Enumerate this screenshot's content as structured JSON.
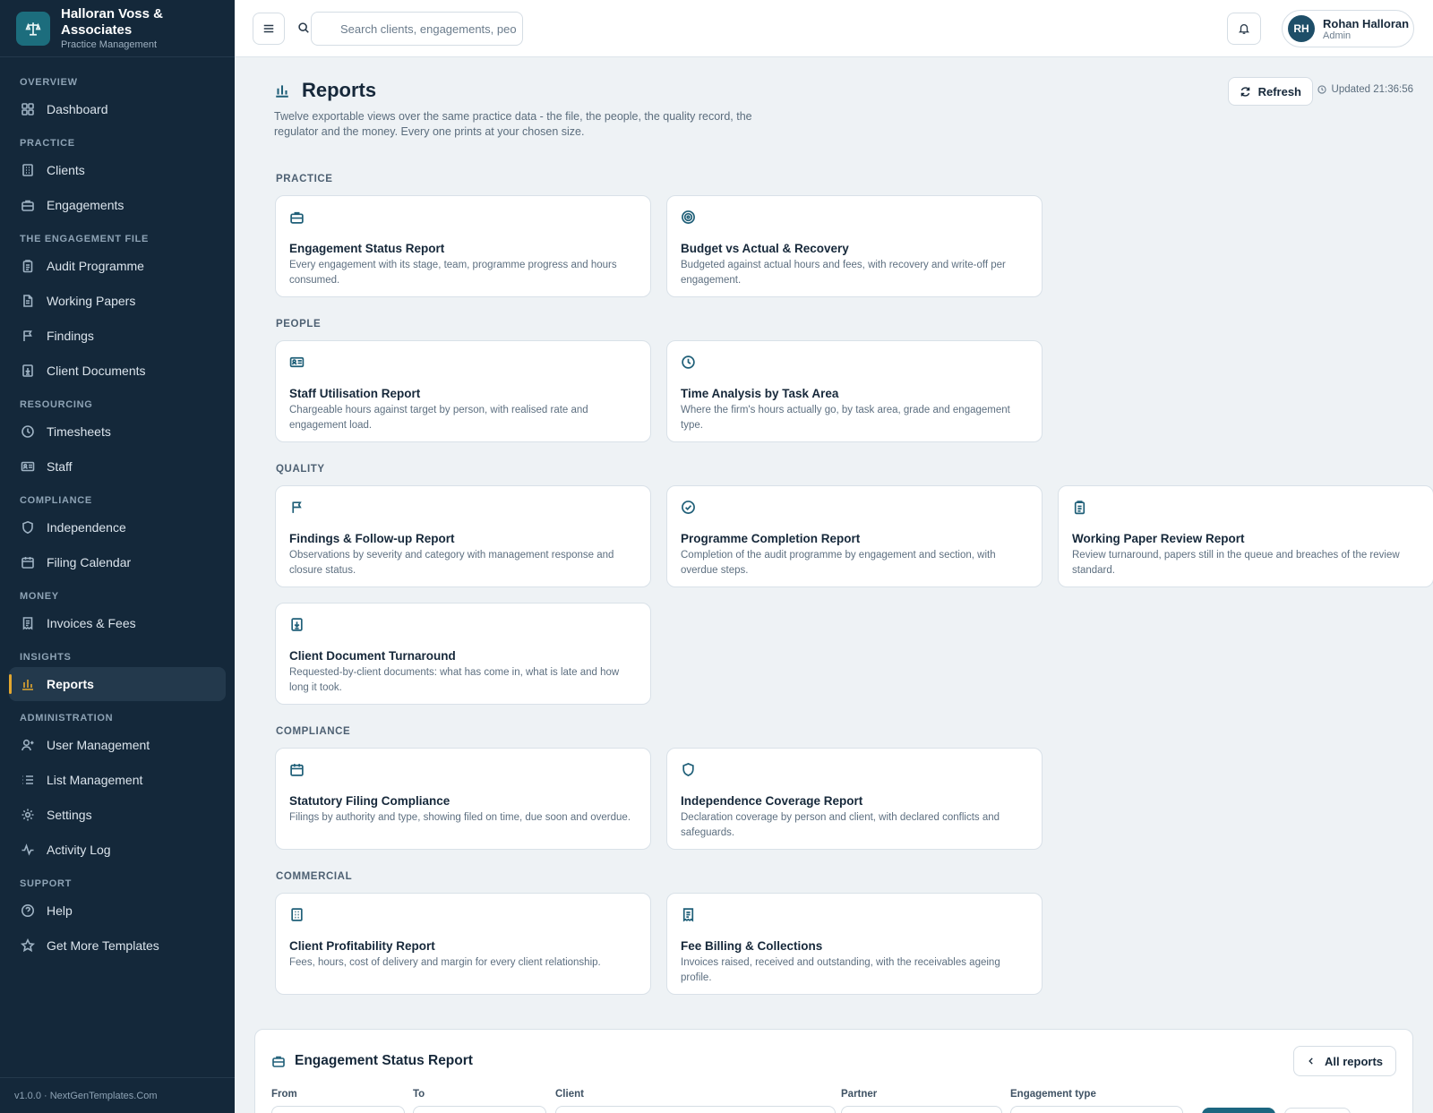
{
  "brand": {
    "name": "Halloran Voss & Associates",
    "subtitle": "Practice Management"
  },
  "sidebar": {
    "sections": [
      {
        "label": "OVERVIEW",
        "items": [
          {
            "label": "Dashboard",
            "icon": "grid-icon"
          }
        ]
      },
      {
        "label": "PRACTICE",
        "items": [
          {
            "label": "Clients",
            "icon": "building-icon"
          },
          {
            "label": "Engagements",
            "icon": "briefcase-icon"
          }
        ]
      },
      {
        "label": "THE ENGAGEMENT FILE",
        "items": [
          {
            "label": "Audit Programme",
            "icon": "clipboard-icon"
          },
          {
            "label": "Working Papers",
            "icon": "file-icon"
          },
          {
            "label": "Findings",
            "icon": "flag-icon"
          },
          {
            "label": "Client Documents",
            "icon": "file-download-icon"
          }
        ]
      },
      {
        "label": "RESOURCING",
        "items": [
          {
            "label": "Timesheets",
            "icon": "clock-icon"
          },
          {
            "label": "Staff",
            "icon": "id-card-icon"
          }
        ]
      },
      {
        "label": "COMPLIANCE",
        "items": [
          {
            "label": "Independence",
            "icon": "shield-icon"
          },
          {
            "label": "Filing Calendar",
            "icon": "calendar-icon"
          }
        ]
      },
      {
        "label": "MONEY",
        "items": [
          {
            "label": "Invoices & Fees",
            "icon": "receipt-icon"
          }
        ]
      },
      {
        "label": "INSIGHTS",
        "items": [
          {
            "label": "Reports",
            "icon": "bar-chart-icon",
            "active": true
          }
        ]
      },
      {
        "label": "ADMINISTRATION",
        "items": [
          {
            "label": "User Management",
            "icon": "user-icon"
          },
          {
            "label": "List Management",
            "icon": "list-icon"
          },
          {
            "label": "Settings",
            "icon": "gear-icon"
          },
          {
            "label": "Activity Log",
            "icon": "activity-icon"
          }
        ]
      },
      {
        "label": "SUPPORT",
        "items": [
          {
            "label": "Help",
            "icon": "help-icon"
          },
          {
            "label": "Get More Templates",
            "icon": "star-icon"
          }
        ]
      }
    ],
    "footer": "v1.0.0 · NextGenTemplates.Com"
  },
  "topbar": {
    "search_placeholder": "Search clients, engagements, peo",
    "user": {
      "initials": "RH",
      "name": "Rohan Halloran",
      "role": "Admin"
    }
  },
  "page": {
    "title": "Reports",
    "subtitle": "Twelve exportable views over the same practice data - the file, the people, the quality record, the regulator and the money. Every one prints at your chosen size.",
    "refresh_label": "Refresh",
    "updated_label": "Updated 21:36:56"
  },
  "report_sections": [
    {
      "label": "PRACTICE",
      "cards": [
        {
          "icon": "briefcase-icon",
          "title": "Engagement Status Report",
          "desc": "Every engagement with its stage, team, programme progress and hours consumed."
        },
        {
          "icon": "target-icon",
          "title": "Budget vs Actual & Recovery",
          "desc": "Budgeted against actual hours and fees, with recovery and write-off per engagement."
        }
      ]
    },
    {
      "label": "PEOPLE",
      "cards": [
        {
          "icon": "id-card-icon",
          "title": "Staff Utilisation Report",
          "desc": "Chargeable hours against target by person, with realised rate and engagement load."
        },
        {
          "icon": "clock-icon",
          "title": "Time Analysis by Task Area",
          "desc": "Where the firm's hours actually go, by task area, grade and engagement type."
        }
      ]
    },
    {
      "label": "QUALITY",
      "cards": [
        {
          "icon": "flag-icon",
          "title": "Findings & Follow-up Report",
          "desc": "Observations by severity and category with management response and closure status."
        },
        {
          "icon": "check-circle-icon",
          "title": "Programme Completion Report",
          "desc": "Completion of the audit programme by engagement and section, with overdue steps."
        },
        {
          "icon": "clipboard-icon",
          "title": "Working Paper Review Report",
          "desc": "Review turnaround, papers still in the queue and breaches of the review standard."
        },
        {
          "icon": "file-download-icon",
          "title": "Client Document Turnaround",
          "desc": "Requested-by-client documents: what has come in, what is late and how long it took."
        }
      ]
    },
    {
      "label": "COMPLIANCE",
      "cards": [
        {
          "icon": "calendar-icon",
          "title": "Statutory Filing Compliance",
          "desc": "Filings by authority and type, showing filed on time, due soon and overdue."
        },
        {
          "icon": "shield-icon",
          "title": "Independence Coverage Report",
          "desc": "Declaration coverage by person and client, with declared conflicts and safeguards."
        }
      ]
    },
    {
      "label": "COMMERCIAL",
      "cards": [
        {
          "icon": "building-icon",
          "title": "Client Profitability Report",
          "desc": "Fees, hours, cost of delivery and margin for every client relationship."
        },
        {
          "icon": "receipt-icon",
          "title": "Fee Billing & Collections",
          "desc": "Invoices raised, received and outstanding, with the receivables ageing profile."
        }
      ]
    }
  ],
  "detail": {
    "title": "Engagement Status Report",
    "back_label": "All reports",
    "filters": {
      "from": "From",
      "to": "To",
      "client": "Client",
      "partner": "Partner",
      "engagement_type": "Engagement type"
    }
  }
}
